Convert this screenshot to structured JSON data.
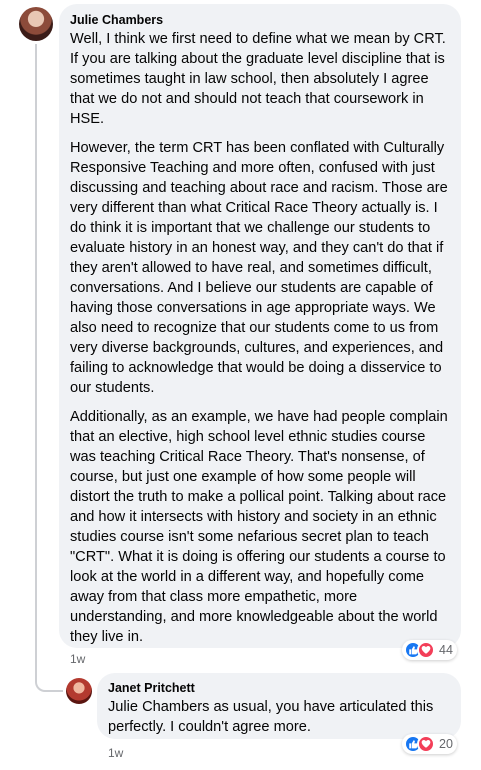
{
  "comment": {
    "author": "Julie Chambers",
    "paragraphs": [
      "Well, I think we first need to define what we mean by CRT. If you are talking about the graduate level discipline that is sometimes taught in law school, then absolutely I agree that we do not and should not teach that coursework in HSE.",
      "However, the term CRT has been conflated with Culturally Responsive Teaching and more often, confused with just discussing and teaching about race and racism. Those are very different than what Critical Race Theory actually is. I do think it is important that we challenge our students to evaluate history in an honest way, and they can't do that if they aren't allowed to have real, and sometimes difficult, conversations. And I believe our students are capable of having those conversations in age appropriate ways. We also need to recognize that our students come to us from very diverse backgrounds, cultures, and experiences, and failing to acknowledge that would be doing a disservice to our students.",
      "Additionally, as an example, we have had people complain that an elective, high school level ethnic studies course was teaching Critical Race Theory. That's nonsense, of course, but just one example of how some people will distort the truth to make a pollical point. Talking about race and how it intersects with history and society in an ethnic studies course isn't some nefarious secret plan to teach \"CRT\". What it is doing is offering our students a course to look at the world in a different way, and hopefully come away from that class more empathetic, more understanding, and more knowledgeable about the world they live in."
    ],
    "time": "1w",
    "reaction_count": "44",
    "reaction_icons": [
      "like-icon",
      "love-icon"
    ]
  },
  "reply": {
    "author": "Janet Pritchett",
    "text": "Julie Chambers as usual, you have articulated this perfectly. I couldn't agree more.",
    "time": "1w",
    "reaction_count": "20",
    "reaction_icons": [
      "like-icon",
      "love-icon"
    ]
  },
  "colors": {
    "bubble": "#f0f2f5",
    "like": "#1877f2",
    "love": "#f33e58",
    "meta_text": "#65676b"
  }
}
